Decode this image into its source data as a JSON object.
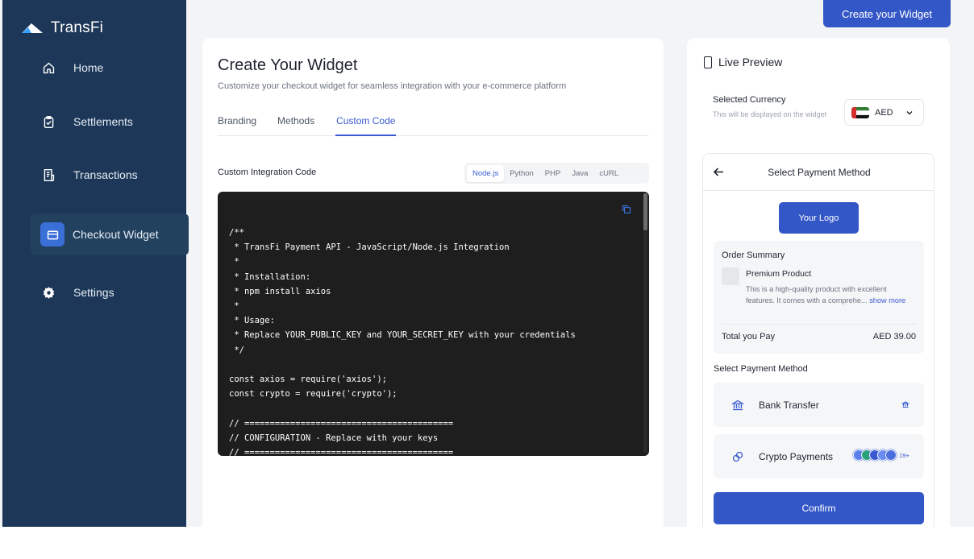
{
  "app": {
    "brand": "TransFi"
  },
  "sidebar": {
    "items": [
      {
        "label": "Home",
        "icon": "home-icon"
      },
      {
        "label": "Settlements",
        "icon": "clipboard-check-icon"
      },
      {
        "label": "Transactions",
        "icon": "receipt-icon"
      },
      {
        "label": "Checkout Widget",
        "icon": "credit-card-icon",
        "active": true
      },
      {
        "label": "Settings",
        "icon": "gear-icon"
      }
    ]
  },
  "header": {
    "create_button": "Create your Widget"
  },
  "main": {
    "title": "Create Your Widget",
    "subtitle": "Customize your checkout widget for seamless integration with your e-commerce platform",
    "tabs": [
      {
        "label": "Branding"
      },
      {
        "label": "Methods"
      },
      {
        "label": "Custom Code",
        "active": true
      }
    ],
    "code_label": "Custom Integration Code",
    "languages": [
      {
        "label": "Node.js",
        "active": true
      },
      {
        "label": "Python"
      },
      {
        "label": "PHP"
      },
      {
        "label": "Java"
      },
      {
        "label": "cURL"
      }
    ],
    "code": "/**\n * TransFi Payment API - JavaScript/Node.js Integration\n *\n * Installation:\n * npm install axios\n *\n * Usage:\n * Replace YOUR_PUBLIC_KEY and YOUR_SECRET_KEY with your credentials\n */\n\nconst axios = require('axios');\nconst crypto = require('crypto');\n\n// =========================================\n// CONFIGURATION - Replace with your keys\n// ========================================="
  },
  "preview": {
    "title": "Live Preview",
    "currency_label": "Selected Currency",
    "currency_hint": "This will be displayed on the widget",
    "currency_value": "AED",
    "widget_title": "Select Payment Method",
    "logo_button": "Your Logo",
    "order_title": "Order Summary",
    "product_name": "Premium Product",
    "product_desc": "This is a high-quality product with excellent features. It comes with a comprehe... ",
    "show_more": "show more",
    "total_label": "Total you Pay",
    "total_value": "AED 39.00",
    "select_label": "Select Payment Method",
    "methods": [
      {
        "label": "Bank Transfer",
        "icon": "bank-icon"
      },
      {
        "label": "Crypto Payments",
        "icon": "crypto-icon"
      }
    ],
    "crypto_more": "19+",
    "confirm": "Confirm"
  },
  "colors": {
    "sidebar": "#1c3757",
    "accent": "#3457c7",
    "code_bg": "#1e1e1e"
  }
}
